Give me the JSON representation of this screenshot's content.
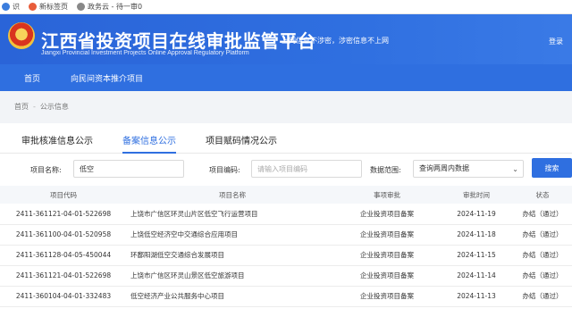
{
  "bookmarks": [
    {
      "label": "识",
      "color": "#3b7ddd"
    },
    {
      "label": "新标签页",
      "color": "#e85d3a"
    },
    {
      "label": "政务云 - 待一审0",
      "color": "#888888"
    }
  ],
  "header": {
    "title": "江西省投资项目在线审批监管平台",
    "subtitle": "Jiangxi Provincial Investment Projects Online Approval Regulatory Platform",
    "slogan": "上网信息不涉密，涉密信息不上网",
    "login": "登录"
  },
  "nav": [
    "首页",
    "向民间资本推介项目"
  ],
  "breadcrumb": {
    "home": "首页",
    "sep": "-",
    "current": "公示信息"
  },
  "tabs": [
    {
      "label": "审批核准信息公示",
      "active": false
    },
    {
      "label": "备案信息公示",
      "active": true
    },
    {
      "label": "项目赋码情况公示",
      "active": false
    }
  ],
  "filters": {
    "name_label": "项目名称:",
    "name_value": "低空",
    "code_label": "项目编码:",
    "code_placeholder": "请输入项目编码",
    "range_label": "数据范围:",
    "range_value": "查询两周内数据",
    "search_label": "搜索"
  },
  "table": {
    "headers": [
      "项目代码",
      "项目名称",
      "事项审批",
      "审批时间",
      "状态"
    ],
    "rows": [
      {
        "code": "2411-361121-04-01-522698",
        "name": "上饶市广信区环灵山片区低空飞行运营项目",
        "type": "企业投资项目备案",
        "date": "2024-11-19",
        "status": "办结（通过）"
      },
      {
        "code": "2411-361100-04-01-520958",
        "name": "上饶低空经济空中交通综合应用项目",
        "type": "企业投资项目备案",
        "date": "2024-11-18",
        "status": "办结（通过）"
      },
      {
        "code": "2411-361128-04-05-450044",
        "name": "环鄱阳湖低空交通综合发展项目",
        "type": "企业投资项目备案",
        "date": "2024-11-15",
        "status": "办结（通过）"
      },
      {
        "code": "2411-361121-04-01-522698",
        "name": "上饶市广信区环灵山景区低空旅游项目",
        "type": "企业投资项目备案",
        "date": "2024-11-14",
        "status": "办结（通过）"
      },
      {
        "code": "2411-360104-04-01-332483",
        "name": "低空经济产业公共服务中心项目",
        "type": "企业投资项目备案",
        "date": "2024-11-13",
        "status": "办结（通过）"
      }
    ]
  }
}
